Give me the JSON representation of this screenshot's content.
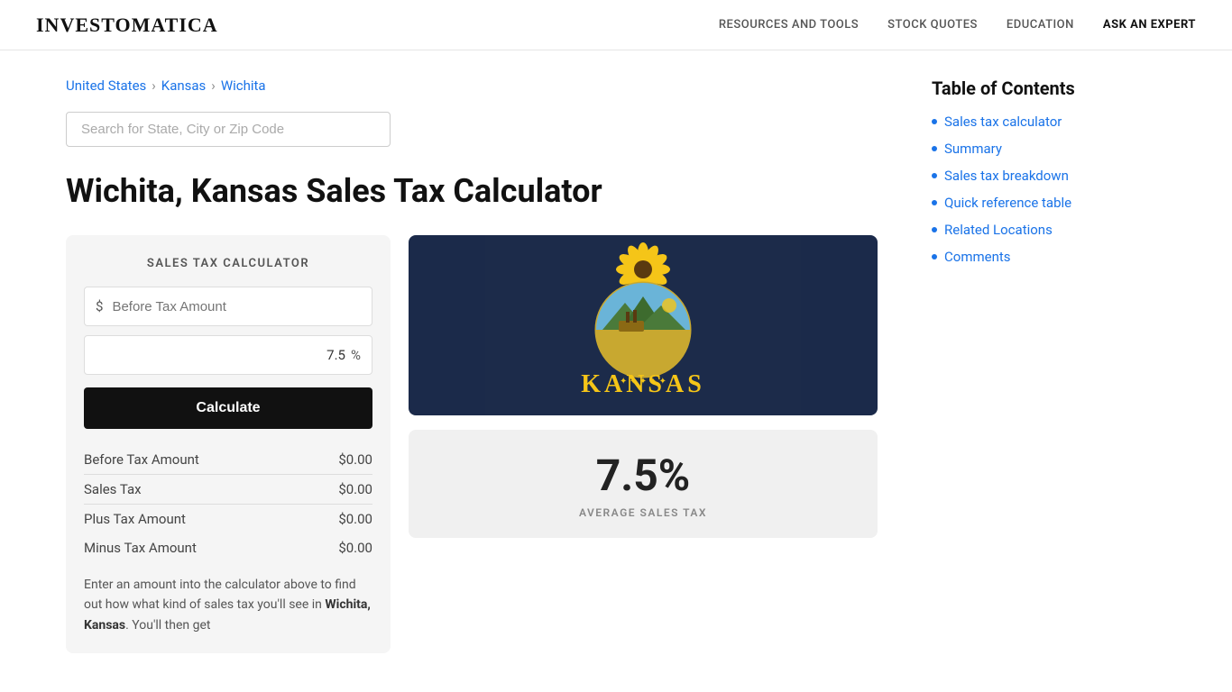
{
  "header": {
    "logo": "INVESTOMATICA",
    "nav": [
      {
        "label": "RESOURCES AND TOOLS",
        "id": "resources"
      },
      {
        "label": "STOCK QUOTES",
        "id": "stock-quotes"
      },
      {
        "label": "EDUCATION",
        "id": "education"
      },
      {
        "label": "ASK AN EXPERT",
        "id": "ask-expert",
        "highlight": true
      }
    ]
  },
  "breadcrumb": {
    "items": [
      "United States",
      "Kansas",
      "Wichita"
    ],
    "separator": "›"
  },
  "search": {
    "placeholder": "Search for State, City or Zip Code"
  },
  "page_title": "Wichita, Kansas Sales Tax Calculator",
  "calculator": {
    "title": "SALES TAX CALCULATOR",
    "amount_placeholder": "Before Tax Amount",
    "amount_prefix": "$",
    "tax_rate": "7.5",
    "tax_rate_suffix": "%",
    "calculate_label": "Calculate",
    "results": [
      {
        "label": "Before Tax Amount",
        "value": "$0.00",
        "divider": true
      },
      {
        "label": "Sales Tax",
        "value": "$0.00",
        "divider": false
      },
      {
        "label": "Plus Tax Amount",
        "value": "$0.00",
        "divider": false
      },
      {
        "label": "Minus Tax Amount",
        "value": "$0.00",
        "divider": false
      }
    ],
    "description": "Enter an amount into the calculator above to find out how what kind of sales tax you'll see in ",
    "location_bold": "Wichita, Kansas",
    "description2": ". You'll then get"
  },
  "flag_card": {
    "state_name": "KANSAS"
  },
  "tax_rate_card": {
    "rate": "7.5%",
    "label": "AVERAGE SALES TAX"
  },
  "toc": {
    "title": "Table of Contents",
    "items": [
      {
        "label": "Sales tax calculator",
        "id": "calc"
      },
      {
        "label": "Summary",
        "id": "summary"
      },
      {
        "label": "Sales tax breakdown",
        "id": "breakdown"
      },
      {
        "label": "Quick reference table",
        "id": "ref-table"
      },
      {
        "label": "Related Locations",
        "id": "related"
      },
      {
        "label": "Comments",
        "id": "comments"
      }
    ]
  }
}
